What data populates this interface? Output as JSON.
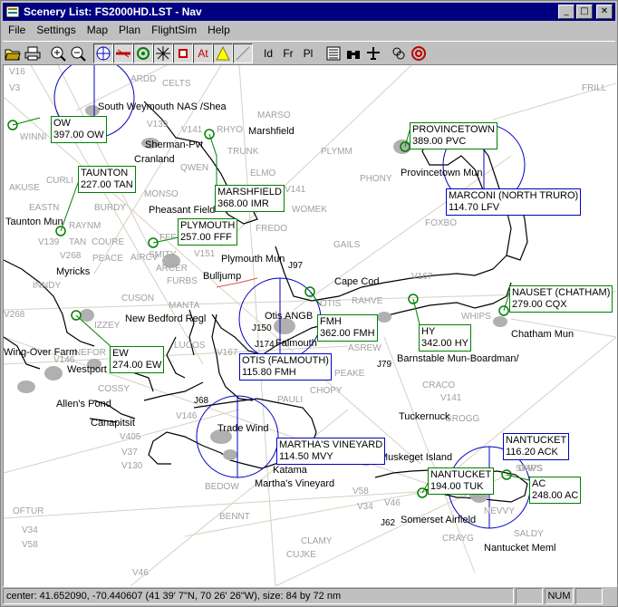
{
  "window": {
    "title": "Scenery List: FS2000HD.LST - Nav"
  },
  "menu": [
    {
      "label": "File"
    },
    {
      "label": "Settings"
    },
    {
      "label": "Map"
    },
    {
      "label": "Plan"
    },
    {
      "label": "FlightSim"
    },
    {
      "label": "Help"
    }
  ],
  "toolbar": {
    "buttons": [
      "open-icon",
      "print-icon",
      "zoom-in-icon",
      "zoom-out-icon",
      "compass-icon",
      "runway-icon",
      "vor-icon",
      "ndb-icon",
      "marker-icon",
      "atc-icon",
      "warning-icon",
      "fix-icon",
      "id-label-icon",
      "freq-label-icon",
      "place-label-icon",
      "list-icon",
      "binoculars-icon",
      "airplane-icon",
      "waypoint-icon",
      "target-icon"
    ],
    "id_label": "Id",
    "freq_label": "Fr",
    "place_label": "Pl",
    "atc_label": "At"
  },
  "map": {
    "airways": [
      "V16",
      "V3",
      "V139",
      "V141",
      "V141",
      "V139",
      "V268",
      "V151",
      "V167",
      "V268",
      "V146",
      "V167",
      "V141",
      "V405",
      "V37",
      "V130",
      "V146",
      "V58",
      "V34",
      "V46",
      "V34",
      "V58",
      "V46"
    ],
    "intersections": [
      "ARDD",
      "CELTS",
      "FRILL",
      "MARSO",
      "RHYO",
      "TRUNK",
      "WINNI",
      "QWEN",
      "ELMO",
      "PLYMM",
      "PHONY",
      "CURLI",
      "AKUSE",
      "EASTN",
      "BURDY",
      "MONSO",
      "WOMEK",
      "RAYNM",
      "TAN",
      "COURE",
      "SMITY",
      "FFF",
      "FREDO",
      "GAILS",
      "FOXBO",
      "PEACE",
      "AIRCV",
      "ARCER",
      "FURBS",
      "INNDY",
      "CUSON",
      "MANTA",
      "OTIS",
      "RAHVE",
      "WHIPS",
      "IZZEY",
      "NEFOR",
      "LUCOS",
      "ASREW",
      "PEAKE",
      "CRACO",
      "COSSY",
      "CHOPY",
      "PAULI",
      "GROGG",
      "SKIPS",
      "BEDOW",
      "BENNT",
      "OFTUR",
      "CLAMY",
      "CUJKE",
      "CRAYG",
      "SALDY",
      "NEVVY",
      "GAVS",
      "TUK"
    ],
    "places": [
      "South Weymouth NAS /Shea",
      "Marshfield",
      "Sherman-Pvt",
      "Cranland",
      "Provincetown Mun",
      "Pheasant Field",
      "Taunton Mun",
      "Plymouth Mun",
      "Myricks",
      "Bulljump",
      "Cape Cod",
      "Otis ANGB",
      "Falmouth",
      "New Bedford Regl",
      "Chatham Mun",
      "Barnstable Mun-Boardman/",
      "Wing-Over Farm",
      "Westport",
      "Allen's Pond",
      "Canapitsit",
      "Trade Wind",
      "Katama",
      "Martha's Vineyard",
      "Tuckernuck",
      "Muskeget Island",
      "Somerset Airfield",
      "Nantucket Meml",
      "J97",
      "J150",
      "J174",
      "J79",
      "J68",
      "J62"
    ],
    "navaids": [
      {
        "name": "OW",
        "freq": "397.00 OW",
        "kind": "ndb"
      },
      {
        "name": "TAUNTON",
        "freq": "227.00 TAN",
        "kind": "ndb"
      },
      {
        "name": "MARSHFIELD",
        "freq": "368.00 IMR",
        "kind": "ndb"
      },
      {
        "name": "PLYMOUTH",
        "freq": "257.00 FFF",
        "kind": "ndb"
      },
      {
        "name": "PROVINCETOWN",
        "freq": "389.00 PVC",
        "kind": "ndb"
      },
      {
        "name": "MARCONI (NORTH TRURO)",
        "freq": "114.70 LFV",
        "kind": "vor"
      },
      {
        "name": "NAUSET (CHATHAM)",
        "freq": "279.00 CQX",
        "kind": "ndb"
      },
      {
        "name": "FMH",
        "freq": "362.00 FMH",
        "kind": "ndb"
      },
      {
        "name": "HY",
        "freq": "342.00 HY",
        "kind": "ndb"
      },
      {
        "name": "EW",
        "freq": "274.00 EW",
        "kind": "ndb"
      },
      {
        "name": "OTIS (FALMOUTH)",
        "freq": "115.80 FMH",
        "kind": "vor"
      },
      {
        "name": "MARTHA'S VINEYARD",
        "freq": "114.50 MVY",
        "kind": "vor"
      },
      {
        "name": "NANTUCKET",
        "freq": "116.20 ACK",
        "kind": "vor"
      },
      {
        "name": "NANTUCKET",
        "freq": "194.00 TUK",
        "kind": "ndb"
      },
      {
        "name": "AC",
        "freq": "248.00 AC",
        "kind": "ndb"
      }
    ]
  },
  "status": {
    "text": "center: 41.652090, -70.440607 (41 39' 7\"N, 70 26' 26\"W), size: 84 by 72 nm",
    "num": "NUM"
  }
}
